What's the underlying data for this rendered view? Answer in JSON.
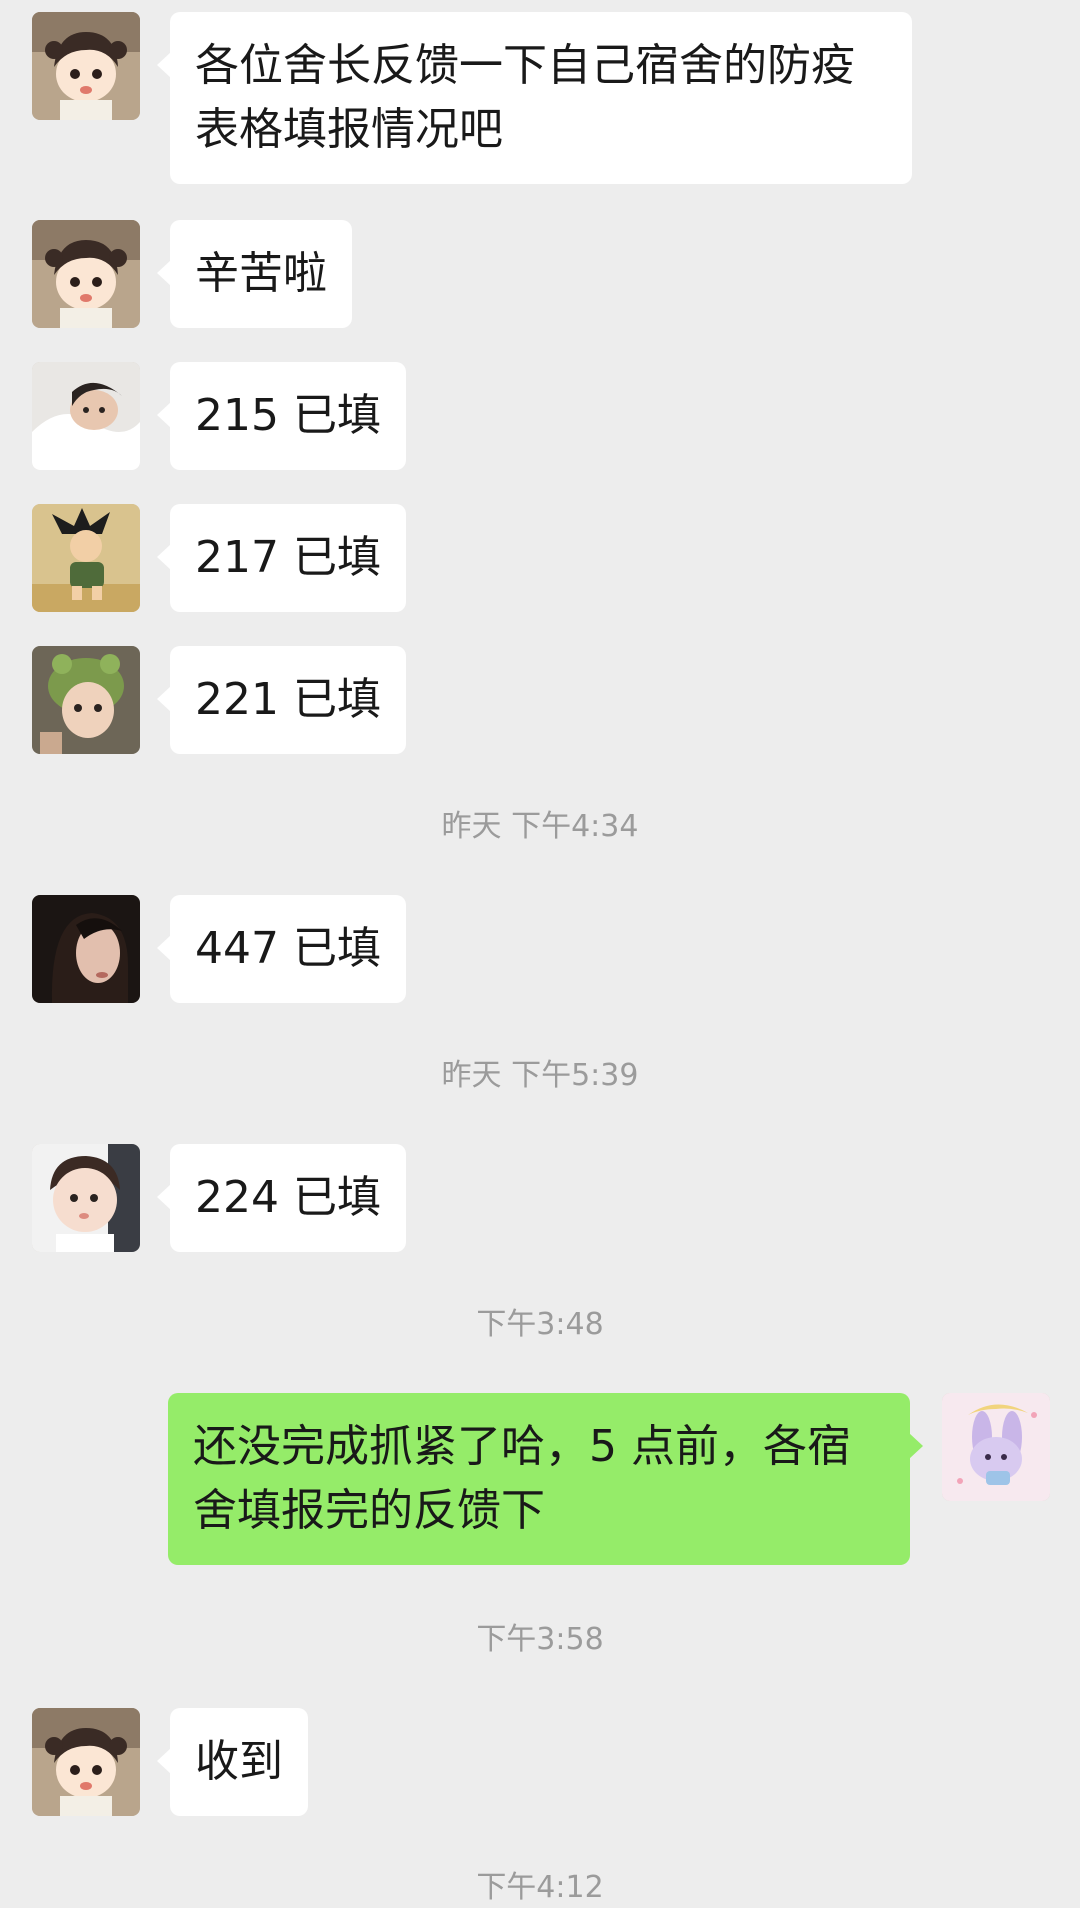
{
  "conversation": {
    "messages": [
      {
        "id": "m1",
        "text": "各位舍长反馈一下自己宿舍的防疫表格填报情况吧",
        "avatar": "anime-girl-avatar"
      },
      {
        "id": "m2",
        "text": "辛苦啦",
        "avatar": "anime-girl-avatar"
      },
      {
        "id": "m3",
        "text": "215 已填",
        "avatar": "girl-in-blanket-avatar"
      },
      {
        "id": "m4",
        "text": "217 已填",
        "avatar": "cartoon-boy-avatar"
      },
      {
        "id": "m5",
        "text": "221 已填",
        "avatar": "child-frog-hat-avatar"
      },
      {
        "id": "m6",
        "text": "447 已填",
        "avatar": "dark-portrait-avatar"
      },
      {
        "id": "m7",
        "text": "224 已填",
        "avatar": "baby-avatar"
      },
      {
        "id": "m8",
        "text": "还没完成抓紧了哈，5 点前，各宿舍填报完的反馈下",
        "avatar": "bunny-sticker-avatar"
      },
      {
        "id": "m9",
        "text": "收到",
        "avatar": "anime-girl-avatar"
      }
    ],
    "timestamps": [
      "昨天 下午4:34",
      "昨天 下午5:39",
      "下午3:48",
      "下午3:58",
      "下午4:12"
    ]
  },
  "colors": {
    "background": "#ededed",
    "incoming_bubble": "#ffffff",
    "outgoing_bubble": "#95ec69",
    "timestamp_text": "#9b9b9b"
  }
}
